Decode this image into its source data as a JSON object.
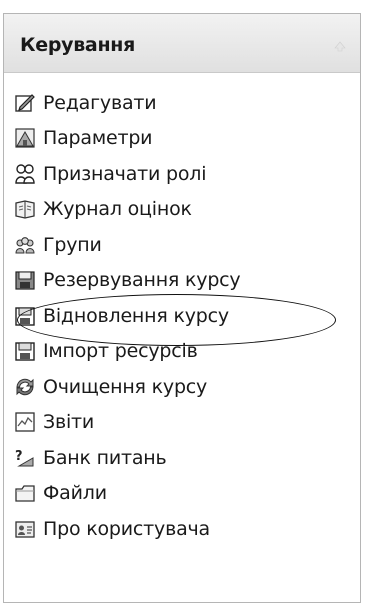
{
  "block": {
    "title": "Керування",
    "collapse_icon": "chevron-up-icon",
    "items": [
      {
        "label": "Редагувати",
        "icon": "edit-icon"
      },
      {
        "label": "Параметри",
        "icon": "settings-icon"
      },
      {
        "label": "Призначати ролі",
        "icon": "roles-icon"
      },
      {
        "label": "Журнал оцінок",
        "icon": "grades-icon"
      },
      {
        "label": "Групи",
        "icon": "groups-icon"
      },
      {
        "label": "Резервування курсу",
        "icon": "backup-icon"
      },
      {
        "label": "Відновлення курсу",
        "icon": "restore-icon"
      },
      {
        "label": "Імпорт ресурсів",
        "icon": "import-icon"
      },
      {
        "label": "Очищення курсу",
        "icon": "reset-icon"
      },
      {
        "label": "Звіти",
        "icon": "reports-icon"
      },
      {
        "label": "Банк питань",
        "icon": "question-bank-icon"
      },
      {
        "label": "Файли",
        "icon": "files-icon"
      },
      {
        "label": "Про користувача",
        "icon": "profile-icon"
      }
    ],
    "highlighted_item": "Резервування курсу"
  }
}
